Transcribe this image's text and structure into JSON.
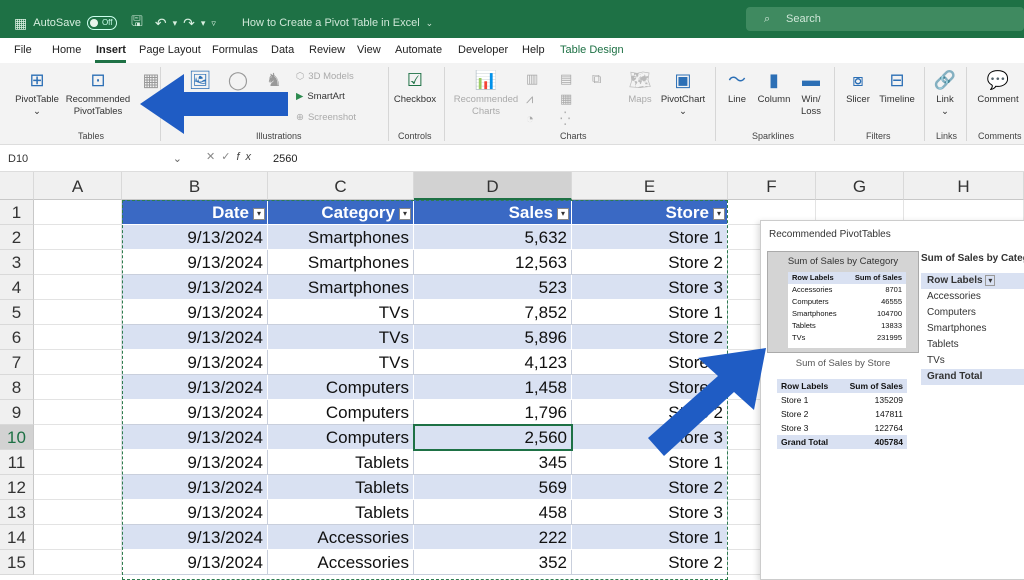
{
  "titlebar": {
    "autosave": "AutoSave",
    "toggle": "Off",
    "doc_title": "How to Create a Pivot Table in Excel",
    "search_placeholder": "Search"
  },
  "menu": [
    "File",
    "Home",
    "Insert",
    "Page Layout",
    "Formulas",
    "Data",
    "Review",
    "View",
    "Automate",
    "Developer",
    "Help",
    "Table Design"
  ],
  "ribbon": {
    "pivottable": "PivotTable",
    "rec_pivot1": "Recommended",
    "rec_pivot2": "PivotTables",
    "tables_group": "Tables",
    "models3d": "3D Models",
    "smartart": "SmartArt",
    "screenshot": "Screenshot",
    "illustrations_group": "Illustrations",
    "checkbox": "Checkbox",
    "controls_group": "Controls",
    "rec_charts1": "Recommended",
    "rec_charts2": "Charts",
    "maps": "Maps",
    "pivotchart": "PivotChart",
    "charts_group": "Charts",
    "line": "Line",
    "column": "Column",
    "winloss1": "Win/",
    "winloss2": "Loss",
    "sparklines_group": "Sparklines",
    "slicer": "Slicer",
    "timeline": "Timeline",
    "filters_group": "Filters",
    "link": "Link",
    "links_group": "Links",
    "comment": "Comment",
    "comments_group": "Comments"
  },
  "formula": {
    "namebox": "D10",
    "value": "2560"
  },
  "grid": {
    "columns": [
      "A",
      "B",
      "C",
      "D",
      "E",
      "F",
      "G",
      "H"
    ],
    "rows": [
      "1",
      "2",
      "3",
      "4",
      "5",
      "6",
      "7",
      "8",
      "9",
      "10",
      "11",
      "12",
      "13",
      "14",
      "15"
    ],
    "headers": [
      "Date",
      "Category",
      "Sales",
      "Store"
    ],
    "data": [
      [
        "9/13/2024",
        "Smartphones",
        "5,632",
        "Store 1"
      ],
      [
        "9/13/2024",
        "Smartphones",
        "12,563",
        "Store 2"
      ],
      [
        "9/13/2024",
        "Smartphones",
        "523",
        "Store 3"
      ],
      [
        "9/13/2024",
        "TVs",
        "7,852",
        "Store 1"
      ],
      [
        "9/13/2024",
        "TVs",
        "5,896",
        "Store 2"
      ],
      [
        "9/13/2024",
        "TVs",
        "4,123",
        "Store 3"
      ],
      [
        "9/13/2024",
        "Computers",
        "1,458",
        "Store 1"
      ],
      [
        "9/13/2024",
        "Computers",
        "1,796",
        "Store 2"
      ],
      [
        "9/13/2024",
        "Computers",
        "2,560",
        "Store 3"
      ],
      [
        "9/13/2024",
        "Tablets",
        "345",
        "Store 1"
      ],
      [
        "9/13/2024",
        "Tablets",
        "569",
        "Store 2"
      ],
      [
        "9/13/2024",
        "Tablets",
        "458",
        "Store 3"
      ],
      [
        "9/13/2024",
        "Accessories",
        "222",
        "Store 1"
      ],
      [
        "9/13/2024",
        "Accessories",
        "352",
        "Store 2"
      ]
    ]
  },
  "dialog": {
    "title": "Recommended PivotTables",
    "opt1_caption": "Sum of Sales by Category",
    "opt1_header": [
      "Row Labels",
      "Sum of Sales"
    ],
    "opt1_rows": [
      [
        "Accessories",
        "8701"
      ],
      [
        "Computers",
        "46555"
      ],
      [
        "Smartphones",
        "104700"
      ],
      [
        "Tablets",
        "13833"
      ],
      [
        "TVs",
        "231995"
      ]
    ],
    "opt2_caption": "Sum of Sales by Store",
    "opt2_header": [
      "Row Labels",
      "Sum of Sales"
    ],
    "opt2_rows": [
      [
        "Store 1",
        "135209"
      ],
      [
        "Store 2",
        "147811"
      ],
      [
        "Store 3",
        "122764"
      ]
    ],
    "opt2_total": [
      "Grand Total",
      "405784"
    ],
    "preview_title": "Sum of Sales by Category",
    "preview_header": "Row Labels",
    "preview_rows": [
      "Accessories",
      "Computers",
      "Smartphones",
      "Tablets",
      "TVs"
    ],
    "preview_total": "Grand Total"
  },
  "colors": {
    "excel_green": "#1e7145",
    "table_header": "#3a69c4",
    "band": "#d9e1f2",
    "arrow": "#1f5cc4"
  }
}
